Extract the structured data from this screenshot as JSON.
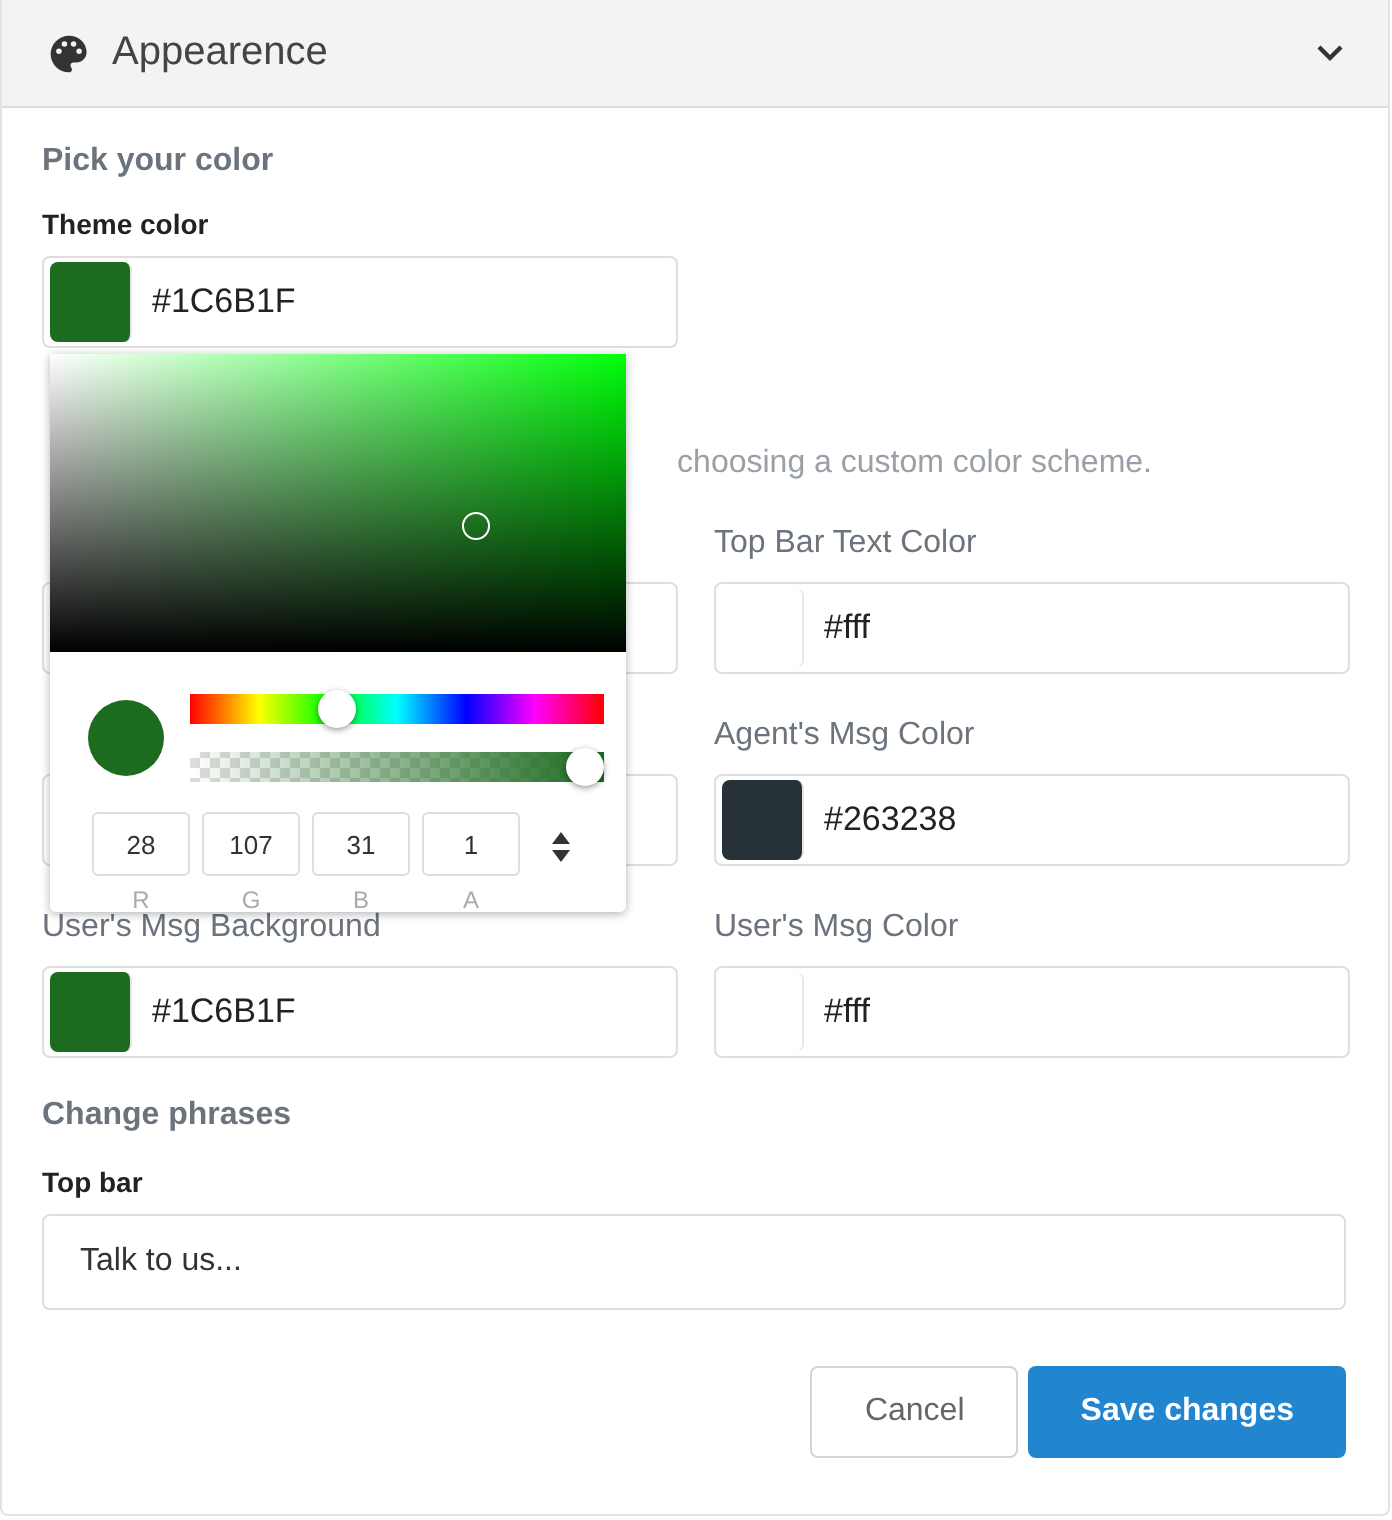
{
  "header": {
    "title": "Appearence",
    "expanded": true
  },
  "pick": {
    "heading": "Pick your color",
    "label": "Theme color",
    "value": "#1C6B1F",
    "color": "#1c6b1f"
  },
  "picker": {
    "open": true,
    "channels": [
      {
        "value": "28",
        "label": "R"
      },
      {
        "value": "107",
        "label": "G"
      },
      {
        "value": "31",
        "label": "B"
      },
      {
        "value": "1",
        "label": "A"
      }
    ]
  },
  "scheme": {
    "description_end": "choosing a custom color scheme.",
    "fields": [
      {
        "kind": "covered"
      },
      {
        "kind": "color",
        "label": "Top Bar Text Color",
        "value": "#fff",
        "color": "#ffffff"
      },
      {
        "kind": "covered"
      },
      {
        "kind": "color",
        "label": "Agent's Msg Color",
        "value": "#263238",
        "color": "#263238"
      },
      {
        "kind": "color",
        "label": "User's Msg Background",
        "value": "#1C6B1F",
        "color": "#1c6b1f"
      },
      {
        "kind": "color",
        "label": "User's Msg Color",
        "value": "#fff",
        "color": "#ffffff"
      }
    ]
  },
  "phrases": {
    "heading": "Change phrases",
    "label": "Top bar",
    "value": "Talk to us..."
  },
  "buttons": [
    {
      "label": "Cancel",
      "kind": "secondary"
    },
    {
      "label": "Save changes",
      "kind": "primary"
    }
  ]
}
